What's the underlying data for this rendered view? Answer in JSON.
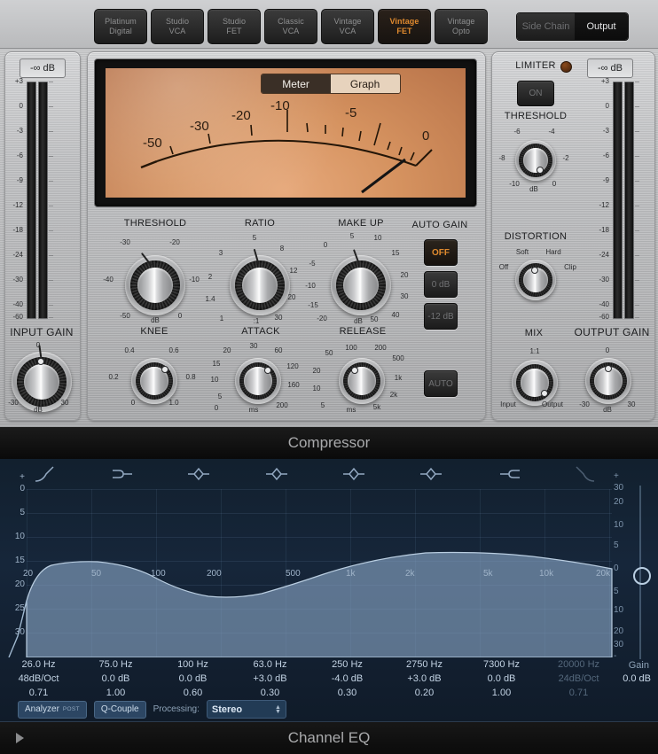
{
  "compressor": {
    "footer_title": "Compressor",
    "models": [
      {
        "l1": "Platinum",
        "l2": "Digital",
        "active": false
      },
      {
        "l1": "Studio",
        "l2": "VCA",
        "active": false
      },
      {
        "l1": "Studio",
        "l2": "FET",
        "active": false
      },
      {
        "l1": "Classic",
        "l2": "VCA",
        "active": false
      },
      {
        "l1": "Vintage",
        "l2": "VCA",
        "active": false
      },
      {
        "l1": "Vintage",
        "l2": "FET",
        "active": true
      },
      {
        "l1": "Vintage",
        "l2": "Opto",
        "active": false
      }
    ],
    "sidechain_label": "Side Chain",
    "output_label": "Output",
    "meter_toggle": {
      "meter": "Meter",
      "graph": "Graph",
      "selected": "Meter"
    },
    "vu_ticks": [
      "-50",
      "-30",
      "-20",
      "-10",
      "-5",
      "0"
    ],
    "input": {
      "readout": "-∞ dB",
      "title": "INPUT GAIN",
      "scale": [
        "+3",
        "0",
        "-3",
        "-6",
        "-9",
        "-12",
        "-18",
        "-24",
        "-30",
        "-40",
        "-60"
      ],
      "knob_min": "-30",
      "knob_max": "30",
      "knob_unit": "dB"
    },
    "output": {
      "readout": "-∞ dB",
      "title": "OUTPUT GAIN",
      "scale": [
        "+3",
        "0",
        "-3",
        "-6",
        "-9",
        "-12",
        "-18",
        "-24",
        "-30",
        "-40",
        "-60"
      ],
      "knob_min": "-30",
      "knob_max": "30",
      "knob_unit": "dB"
    },
    "knobs": {
      "threshold": {
        "title": "THRESHOLD",
        "unit": "dB",
        "ticks": [
          "-50",
          "-40",
          "-30",
          "-20",
          "-10",
          "0"
        ]
      },
      "ratio": {
        "title": "RATIO",
        "unit": ":1",
        "ticks": [
          "1",
          "1.4",
          "2",
          "3",
          "5",
          "8",
          "12",
          "20",
          "30"
        ]
      },
      "makeup": {
        "title": "MAKE UP",
        "unit": "dB",
        "ticks": [
          "-20",
          "-15",
          "-10",
          "-5",
          "0",
          "5",
          "10",
          "15",
          "20",
          "30",
          "40",
          "50"
        ]
      },
      "knee": {
        "title": "KNEE",
        "ticks": [
          "0",
          "0.2",
          "0.4",
          "0.6",
          "0.8",
          "1.0"
        ]
      },
      "attack": {
        "title": "ATTACK",
        "unit": "ms",
        "ticks": [
          "0",
          "5",
          "10",
          "15",
          "20",
          "30",
          "60",
          "120",
          "160",
          "200"
        ]
      },
      "release": {
        "title": "RELEASE",
        "unit": "ms",
        "ticks": [
          "5",
          "10",
          "20",
          "50",
          "100",
          "200",
          "500",
          "1k",
          "2k",
          "5k"
        ]
      }
    },
    "auto_gain": {
      "title": "AUTO GAIN",
      "options": [
        {
          "label": "OFF",
          "active": true
        },
        {
          "label": "0 dB",
          "active": false
        },
        {
          "label": "-12 dB",
          "active": false
        }
      ]
    },
    "auto_release_label": "AUTO",
    "limiter": {
      "title": "LIMITER",
      "on_label": "ON",
      "threshold_title": "THRESHOLD",
      "threshold_unit": "dB",
      "threshold_ticks": [
        "-10",
        "-8",
        "-6",
        "-4",
        "-2",
        "0"
      ]
    },
    "distortion": {
      "title": "DISTORTION",
      "options": [
        "Off",
        "Soft",
        "Hard",
        "Clip"
      ]
    },
    "mix": {
      "title": "MIX",
      "top": "1:1",
      "left": "Input",
      "right": "Output"
    }
  },
  "eq": {
    "footer_title": "Channel EQ",
    "y_left": [
      "+",
      "0",
      "5",
      "10",
      "15",
      "20",
      "25",
      "30"
    ],
    "y_right": [
      "+",
      "30",
      "20",
      "10",
      "5",
      "0",
      "5",
      "10",
      "20",
      "30",
      "-"
    ],
    "freq_ticks": [
      "20",
      "50",
      "100",
      "200",
      "500",
      "1k",
      "2k",
      "5k",
      "10k",
      "20k"
    ],
    "bands": [
      {
        "freq": "26.0 Hz",
        "gain": "48dB/Oct",
        "q": "0.71",
        "enabled": true,
        "type": "highpass"
      },
      {
        "freq": "75.0 Hz",
        "gain": "0.0 dB",
        "q": "1.00",
        "enabled": true,
        "type": "lowshelf"
      },
      {
        "freq": "100 Hz",
        "gain": "0.0 dB",
        "q": "0.60",
        "enabled": true,
        "type": "peak"
      },
      {
        "freq": "63.0 Hz",
        "gain": "+3.0 dB",
        "q": "0.30",
        "enabled": true,
        "type": "peak"
      },
      {
        "freq": "250 Hz",
        "gain": "-4.0 dB",
        "q": "0.30",
        "enabled": true,
        "type": "peak"
      },
      {
        "freq": "2750 Hz",
        "gain": "+3.0 dB",
        "q": "0.20",
        "enabled": true,
        "type": "peak"
      },
      {
        "freq": "7300 Hz",
        "gain": "0.0 dB",
        "q": "1.00",
        "enabled": true,
        "type": "highshelf"
      },
      {
        "freq": "20000 Hz",
        "gain": "24dB/Oct",
        "q": "0.71",
        "enabled": false,
        "type": "lowpass"
      }
    ],
    "analyzer_label": "Analyzer",
    "analyzer_mode": "POST",
    "qcouple_label": "Q-Couple",
    "processing_label": "Processing:",
    "processing_value": "Stereo",
    "gain_label": "Gain",
    "gain_value": "0.0 dB"
  }
}
